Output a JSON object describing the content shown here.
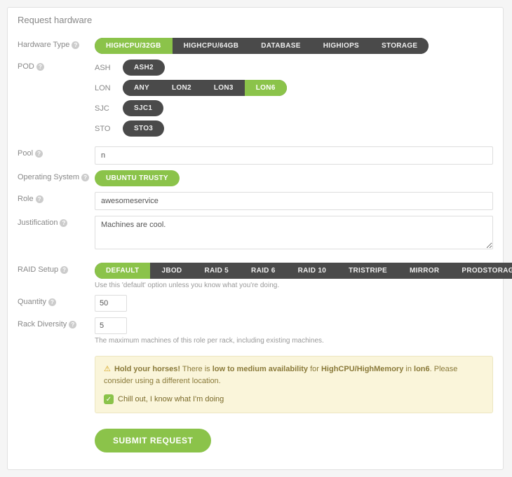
{
  "panel_title": "Request hardware",
  "labels": {
    "hardware_type": "Hardware Type",
    "pod": "POD",
    "pool": "Pool",
    "os": "Operating System",
    "role": "Role",
    "justification": "Justification",
    "raid": "RAID Setup",
    "quantity": "Quantity",
    "rack_diversity": "Rack Diversity"
  },
  "hardware_type": {
    "options": [
      "HIGHCPU/32GB",
      "HIGHCPU/64GB",
      "DATABASE",
      "HIGHIOPS",
      "STORAGE"
    ],
    "selected": "HIGHCPU/32GB"
  },
  "pod": {
    "groups": [
      {
        "name": "ASH",
        "options": [
          "ASH2"
        ],
        "selected": null
      },
      {
        "name": "LON",
        "options": [
          "ANY",
          "LON2",
          "LON3",
          "LON6"
        ],
        "selected": "LON6"
      },
      {
        "name": "SJC",
        "options": [
          "SJC1"
        ],
        "selected": null
      },
      {
        "name": "STO",
        "options": [
          "STO3"
        ],
        "selected": null
      }
    ]
  },
  "pool": {
    "value": "n"
  },
  "os": {
    "options": [
      "UBUNTU TRUSTY"
    ],
    "selected": "UBUNTU TRUSTY"
  },
  "role": {
    "value": "awesomeservice"
  },
  "justification": {
    "value": "Machines are cool."
  },
  "raid": {
    "options": [
      "DEFAULT",
      "JBOD",
      "RAID 5",
      "RAID 6",
      "RAID 10",
      "TRISTRIPE",
      "MIRROR",
      "PRODSTORAGE"
    ],
    "selected": "DEFAULT",
    "hint": "Use this 'default' option unless you know what you're doing."
  },
  "quantity": {
    "value": "50"
  },
  "rack_diversity": {
    "value": "5",
    "hint": "The maximum machines of this role per rack, including existing machines."
  },
  "alert": {
    "strong_lead": "Hold your horses!",
    "t1": " There is ",
    "strong_avail": "low to medium availability",
    "t2": " for ",
    "strong_hw": "HighCPU/HighMemory",
    "t3": " in ",
    "strong_loc": "lon6",
    "t4": ". Please consider using a different location.",
    "checkbox_label": "Chill out, I know what I'm doing",
    "checked": true
  },
  "submit_label": "SUBMIT REQUEST"
}
